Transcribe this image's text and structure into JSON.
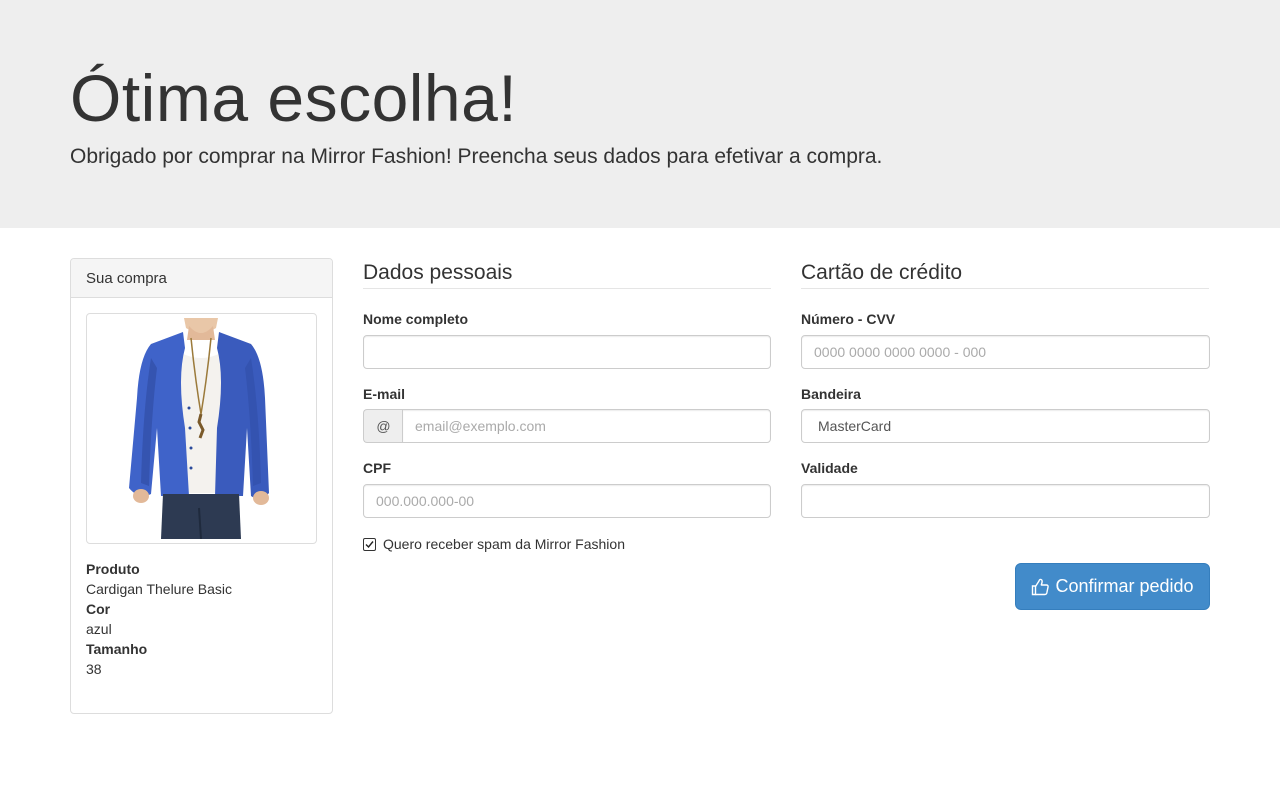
{
  "header": {
    "title": "Ótima escolha!",
    "subtitle": "Obrigado por comprar na Mirror Fashion! Preencha seus dados para efetivar a compra."
  },
  "order": {
    "heading": "Sua compra",
    "product_label": "Produto",
    "product_value": "Cardigan Thelure Basic",
    "color_label": "Cor",
    "color_value": "azul",
    "size_label": "Tamanho",
    "size_value": "38"
  },
  "personal": {
    "legend": "Dados pessoais",
    "name_label": "Nome completo",
    "name_value": "",
    "email_label": "E-mail",
    "email_addon": "@",
    "email_placeholder": "email@exemplo.com",
    "cpf_label": "CPF",
    "cpf_placeholder": "000.000.000-00",
    "spam_label": "Quero receber spam da Mirror Fashion",
    "spam_checked": true
  },
  "card": {
    "legend": "Cartão de crédito",
    "number_label": "Número - CVV",
    "number_placeholder": "0000 0000 0000 0000 - 000",
    "brand_label": "Bandeira",
    "brand_value": "MasterCard",
    "expiry_label": "Validade",
    "expiry_value": ""
  },
  "actions": {
    "confirm_label": "Confirmar pedido"
  },
  "colors": {
    "jumbotron_bg": "#eeeeee",
    "primary": "#428bca",
    "cardigan": "#3f63c9"
  },
  "icons": {
    "confirm": "thumbs-up-icon",
    "checkbox": "check-icon"
  }
}
